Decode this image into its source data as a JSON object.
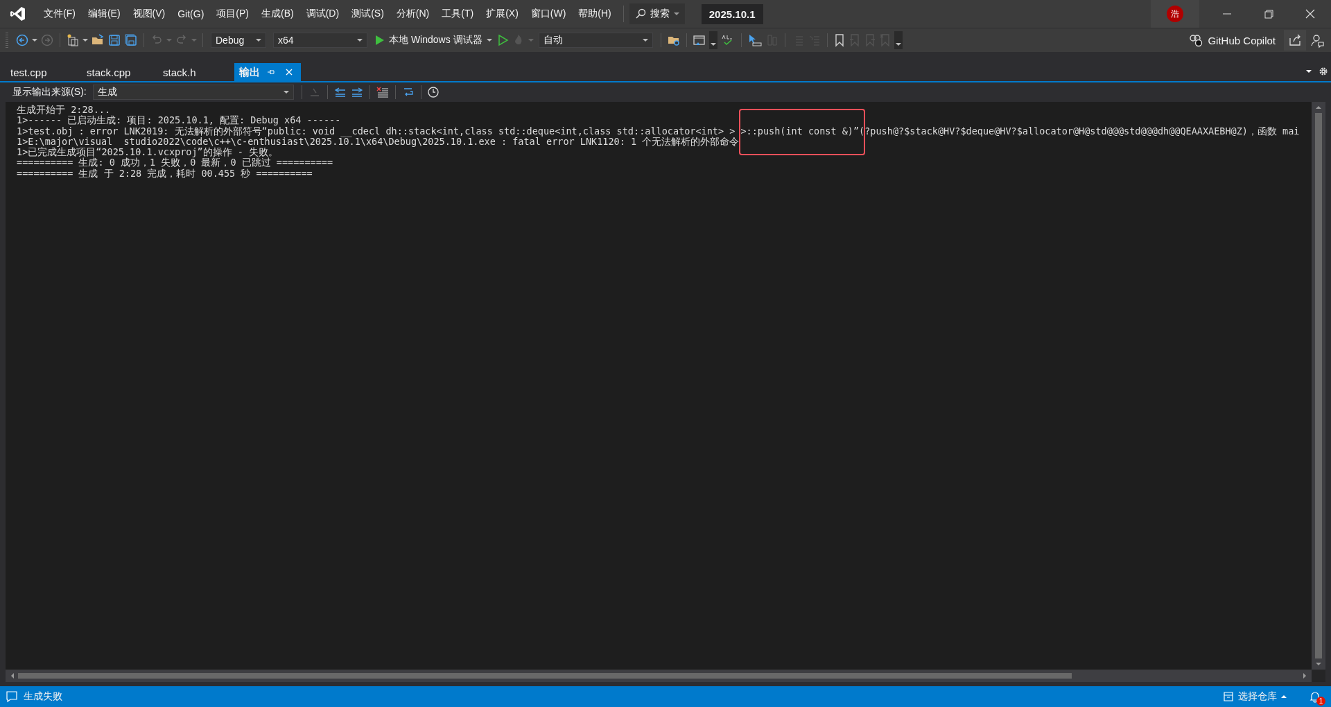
{
  "window": {
    "title": "2025.10.1",
    "avatar": "浩"
  },
  "menu": [
    "文件(F)",
    "编辑(E)",
    "视图(V)",
    "Git(G)",
    "项目(P)",
    "生成(B)",
    "调试(D)",
    "测试(S)",
    "分析(N)",
    "工具(T)",
    "扩展(X)",
    "窗口(W)",
    "帮助(H)"
  ],
  "search": {
    "label": "搜索"
  },
  "toolbar": {
    "configuration": "Debug",
    "platform": "x64",
    "debugger": "本地 Windows 调试器",
    "mode": "自动",
    "copilot": "GitHub Copilot"
  },
  "tabs": [
    {
      "label": "test.cpp",
      "selected": false
    },
    {
      "label": "stack.cpp",
      "selected": false
    },
    {
      "label": "stack.h",
      "selected": false
    },
    {
      "label": "输出",
      "selected": true
    }
  ],
  "output": {
    "source_label": "显示输出来源(S):",
    "source": "生成",
    "lines": [
      "生成开始于 2:28...",
      "1>------ 已启动生成: 项目: 2025.10.1, 配置: Debug x64 ------",
      "1>test.obj : error LNK2019: 无法解析的外部符号“public: void __cdecl dh::stack<int,class std::deque<int,class std::allocator<int> > >::push(int const &)”(?push@?$stack@HV?$deque@HV?$allocator@H@std@@@std@@@dh@@QEAAXAEBH@Z)，函数 mai",
      "1>E:\\major\\visual  studio2022\\code\\c++\\c-enthusiast\\2025.10.1\\x64\\Debug\\2025.10.1.exe : fatal error LNK1120: 1 个无法解析的外部命令",
      "1>已完成生成项目“2025.10.1.vcxproj”的操作 - 失败。",
      "========== 生成: 0 成功，1 失败，0 最新，0 已跳过 ==========",
      "========== 生成 于 2:28 完成，耗时 00.455 秒 =========="
    ]
  },
  "status_bar": {
    "message": "生成失败",
    "repo": "选择仓库",
    "notifications": "1"
  }
}
